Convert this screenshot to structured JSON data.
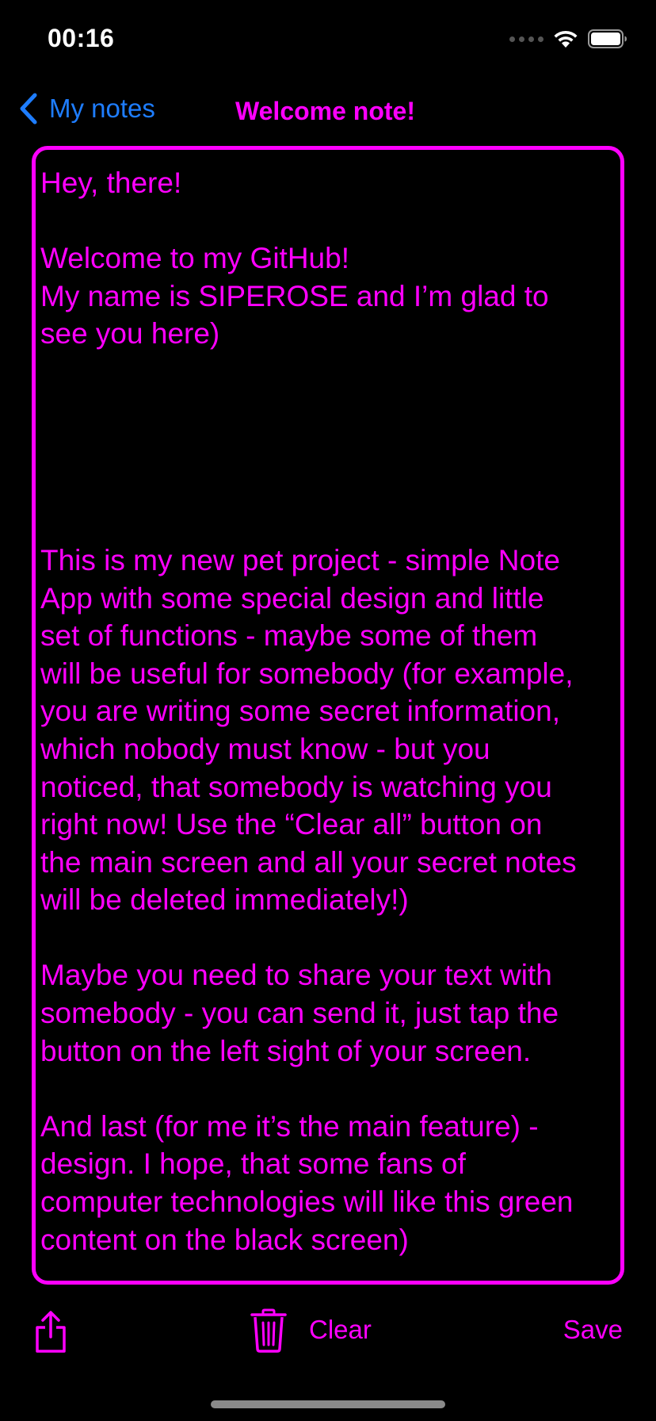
{
  "status_bar": {
    "time": "00:16"
  },
  "nav": {
    "back_label": "My notes",
    "title": "Welcome note!"
  },
  "note": {
    "text": "Hey, there!\n\nWelcome to my GitHub!\nMy name is SIPEROSE and I’m glad to\nsee you here)\n\n\n\n\n\nThis is my new pet project - simple Note\nApp with some special design and little\nset of functions - maybe some of them\nwill be useful for somebody (for example,\nyou are writing some secret information,\nwhich nobody must know - but you\nnoticed, that somebody is watching you\nright now! Use the “Clear all” button on\nthe main screen and all your secret notes\nwill be deleted immediately!)\n\nMaybe you need to share your text with\nsomebody - you can send it, just tap the\nbutton on the left sight of your screen.\n\nAnd last (for me it’s the main feature) -\ndesign. I hope, that some fans of\ncomputer technologies will like this green\ncontent on the black screen)"
  },
  "toolbar": {
    "share_icon": "share-icon",
    "trash_icon": "trash-icon",
    "clear_label": "Clear",
    "save_label": "Save"
  },
  "colors": {
    "accent": "#ff00ff",
    "back_link": "#1e7dff",
    "background": "#000000"
  }
}
